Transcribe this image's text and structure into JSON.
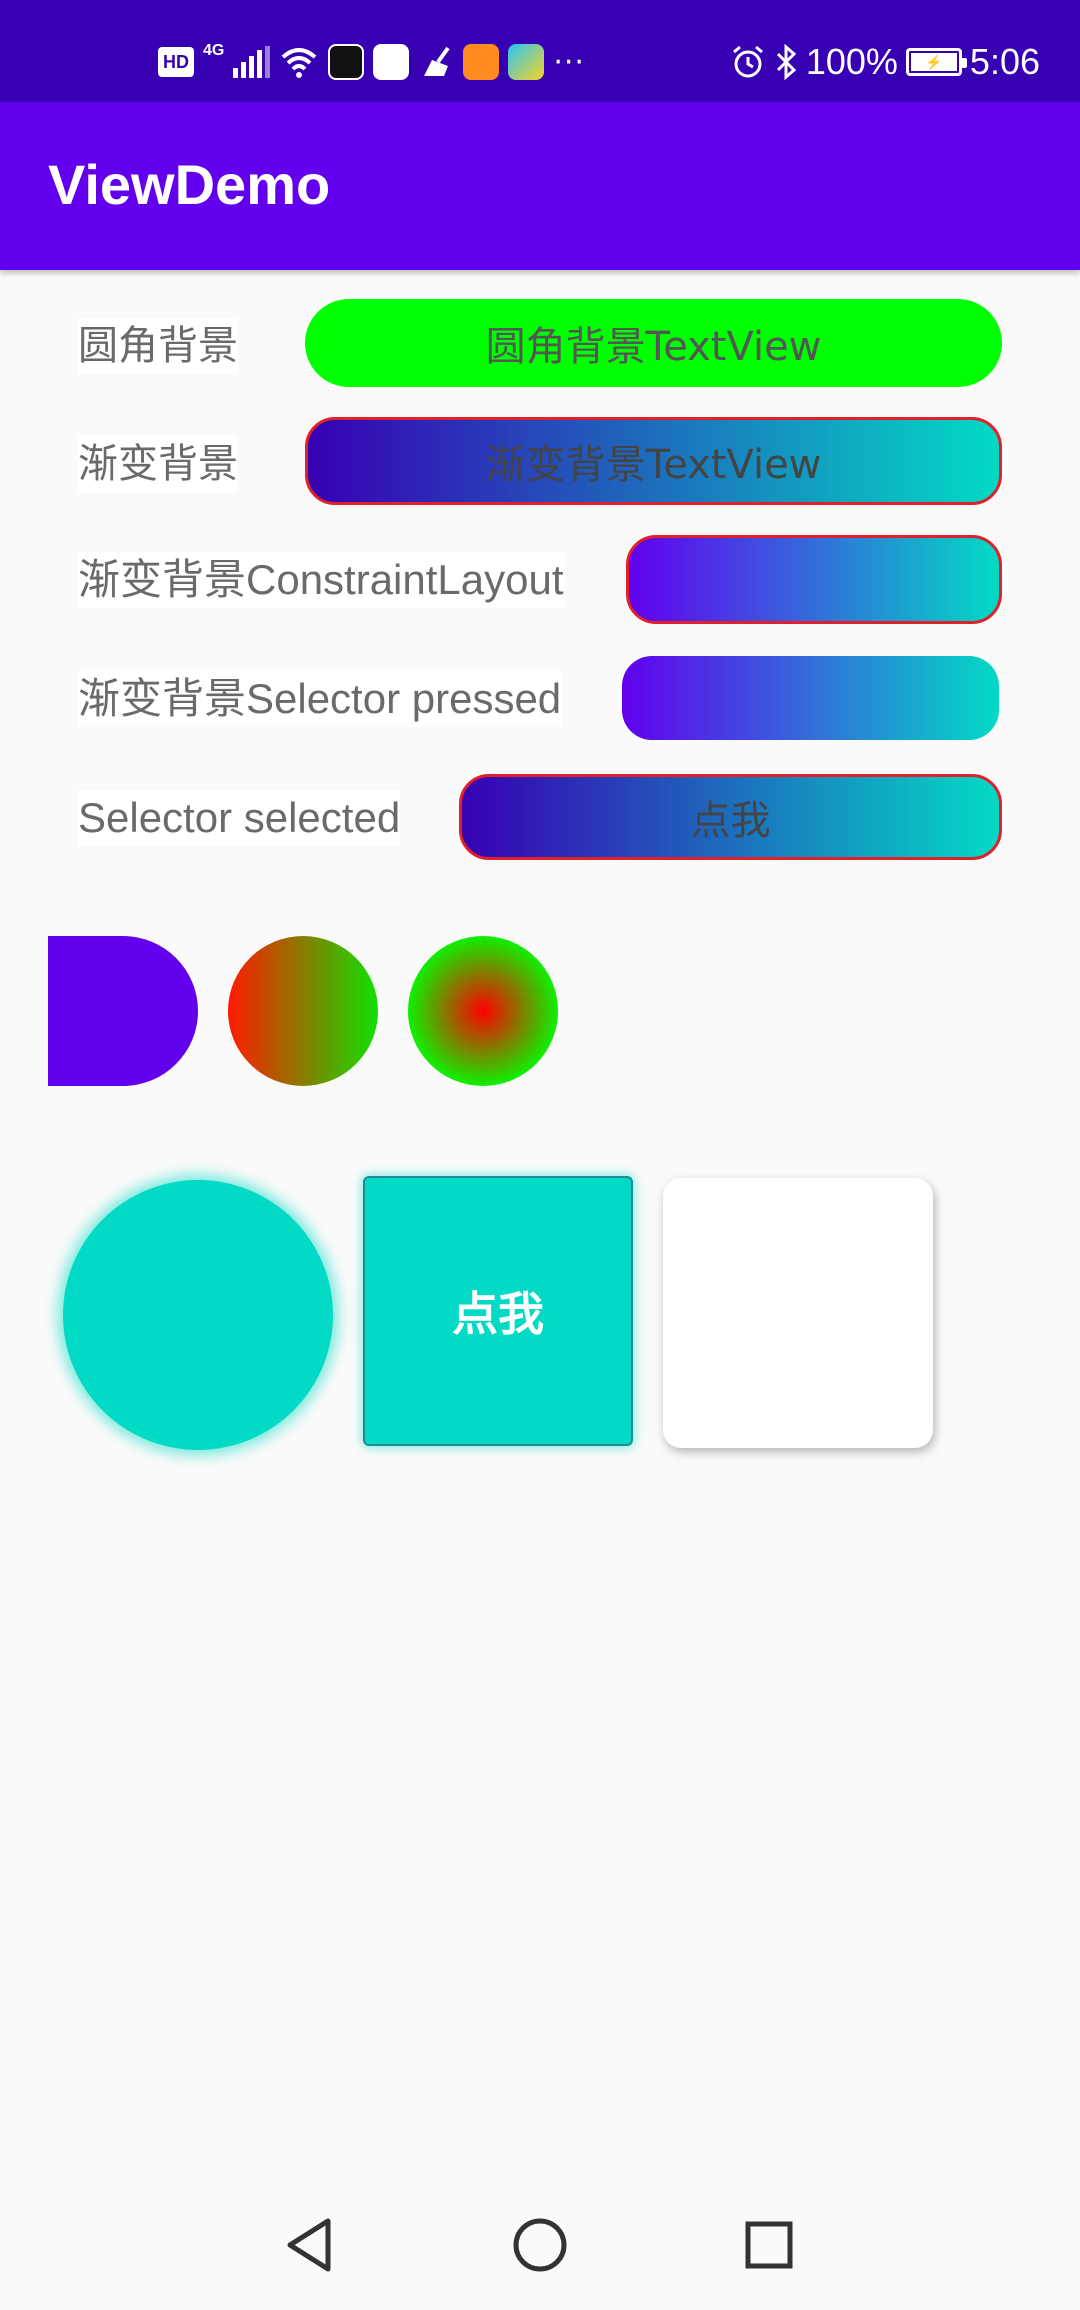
{
  "status_bar": {
    "hd": "HD",
    "network": "4G",
    "battery_percent": "100%",
    "time": "5:06",
    "more": "···",
    "bg_color": "#3700b3"
  },
  "app_bar": {
    "title": "ViewDemo",
    "bg_color": "#6200ee"
  },
  "rows": [
    {
      "label": "圆角背景",
      "button_text": "圆角背景TextView"
    },
    {
      "label": "渐变背景",
      "button_text": "渐变背景TextView"
    },
    {
      "label": "渐变背景ConstraintLayout",
      "button_text": ""
    },
    {
      "label": "渐变背景Selector pressed",
      "button_text": ""
    },
    {
      "label": "Selector selected",
      "button_text": "点我"
    }
  ],
  "shapes": {
    "half_circle_color": "#6200ee",
    "linear_circle_colors": [
      "#ff1a00",
      "#11e000"
    ],
    "radial_circle_colors": [
      "#ff0000",
      "#00ff00"
    ]
  },
  "tiles": {
    "button_text": "点我",
    "accent": "#03dac5"
  },
  "nav": {
    "icons": [
      "back-icon",
      "home-icon",
      "recents-icon"
    ]
  }
}
